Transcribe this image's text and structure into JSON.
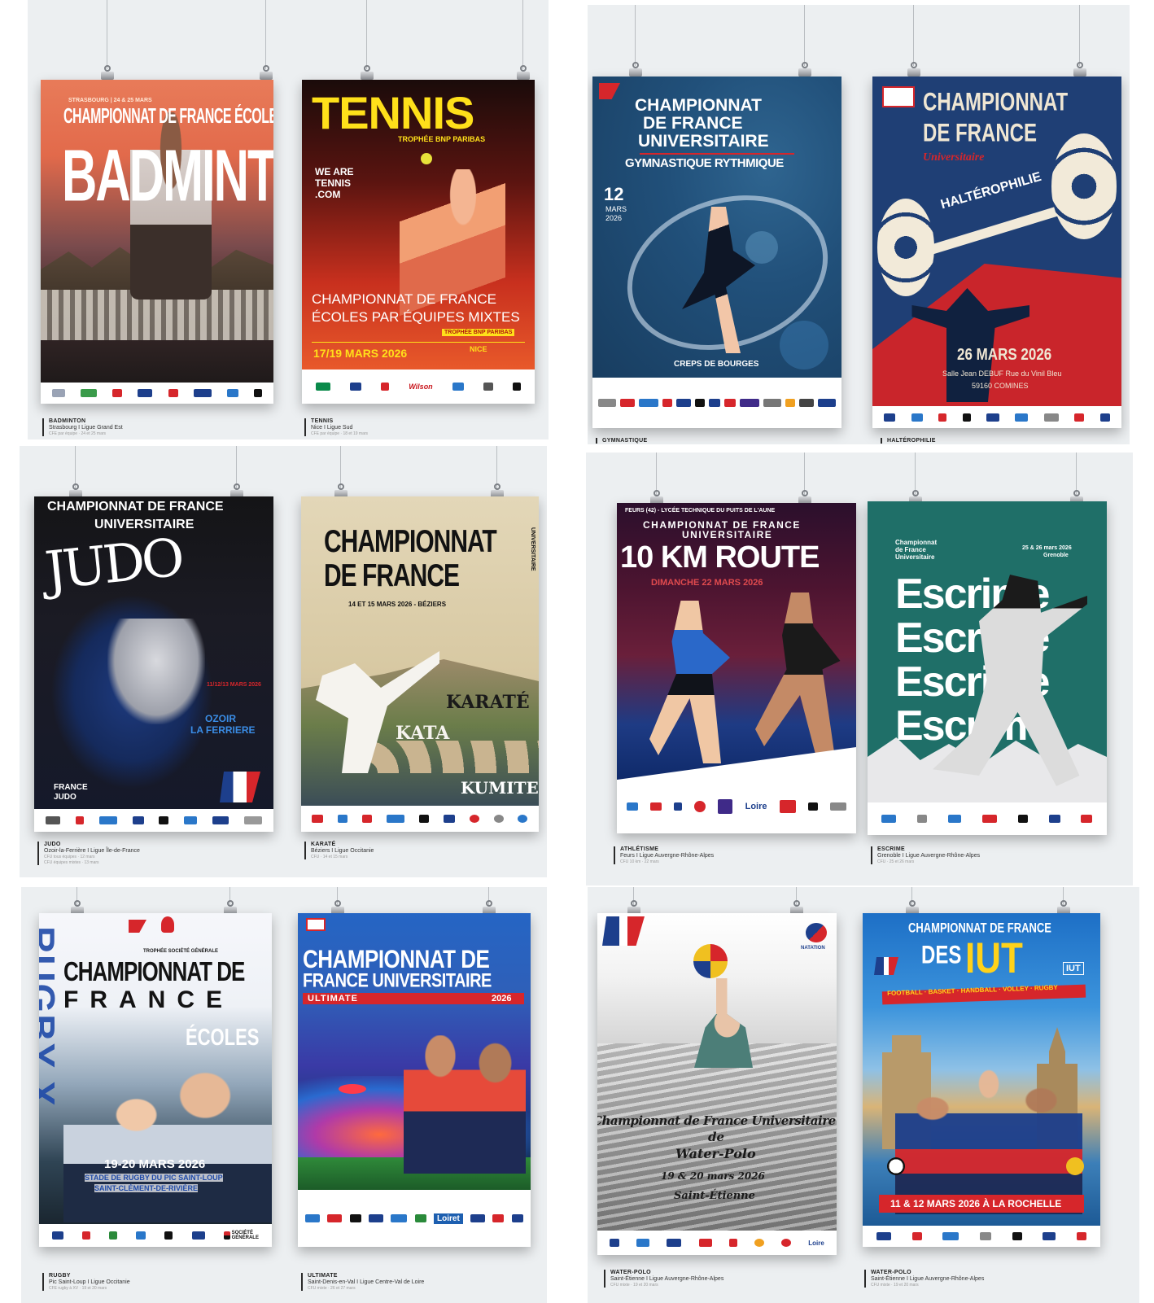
{
  "posters": {
    "badminton": {
      "top_line": "STRASBOURG | 24 & 25 MARS",
      "title": "CHAMPIONNAT DE FRANCE ÉCOLES",
      "sport": "BADMINTON",
      "caption": {
        "sport": "BADMINTON",
        "location": "Strasbourg I Ligue Grand Est",
        "sub": "CFE par équipe · 24 et 25 mars"
      }
    },
    "tennis": {
      "title": "TENNIS",
      "trophy": "TROPHÉE BNP PARIBAS",
      "slogan": [
        "WE ARE",
        "TENNIS",
        ".COM"
      ],
      "championship": "CHAMPIONNAT DE FRANCE",
      "subtitle": "ÉCOLES PAR ÉQUIPES MIXTES",
      "badge": "TROPHÉE BNP PARIBAS",
      "dates": "17/19 MARS 2026",
      "city": "NICE",
      "sponsor": "Wilson",
      "caption": {
        "sport": "TENNIS",
        "location": "Nice I Ligue Sud",
        "sub": "CFE par équipe · 18 et 19 mars"
      }
    },
    "gym": {
      "title": [
        "CHAMPIONNAT",
        "DE FRANCE",
        "UNIVERSITAIRE"
      ],
      "discipline": "GYMNASTIQUE RYTHMIQUE",
      "date_day": "12",
      "date_month": "MARS",
      "date_year": "2026",
      "venue": "CREPS DE BOURGES",
      "caption": {
        "sport": "GYMNASTIQUE"
      }
    },
    "halterophilie": {
      "title": [
        "CHAMPIONNAT",
        "DE FRANCE"
      ],
      "subtitle": "Universitaire",
      "discipline": "HALTÉROPHILIE",
      "date": "26 MARS 2026",
      "address": "Salle Jean DEBUF Rue du Vinil Bleu",
      "postcode": "59160 COMINES",
      "caption": {
        "sport": "HALTÉROPHILIE"
      }
    },
    "judo": {
      "title": [
        "CHAMPIONNAT DE FRANCE",
        "UNIVERSITAIRE"
      ],
      "sport": "JUDO",
      "dates": "11/12/13 MARS 2026",
      "city": [
        "OZOIR",
        "LA FERRIERE"
      ],
      "brand": [
        "FRANCE",
        "JUDO"
      ],
      "caption": {
        "sport": "JUDO",
        "location": "Ozoir-la-Ferrière I Ligue Île-de-France",
        "sub": "CFU tous équipes · 12 mars",
        "sub2": "CFU équipes mixtes · 13 mars"
      }
    },
    "karate": {
      "title": [
        "CHAMPIONNAT",
        "DE FRANCE"
      ],
      "side": "UNIVERSITAIRE",
      "dates": "14 ET 15 MARS 2026 - BÉZIERS",
      "disciplines": [
        "KARATÉ",
        "KATA",
        "KUMITE"
      ],
      "caption": {
        "sport": "KARATÉ",
        "location": "Béziers I Ligue Occitanie",
        "sub": "CFU · 14 et 15 mars"
      }
    },
    "athletisme": {
      "top": "FEURS (42) - LYCÉE TECHNIQUE DU PUITS DE L'AUNE",
      "title": [
        "CHAMPIONNAT DE FRANCE",
        "UNIVERSITAIRE"
      ],
      "event": "10 KM ROUTE",
      "date": "DIMANCHE 22 MARS 2026",
      "sponsor": "Loire",
      "caption": {
        "sport": "ATHLÉTISME",
        "location": "Feurs I Ligue Auvergne-Rhône-Alpes",
        "sub": "CFU 10 km · 22 mars"
      }
    },
    "escrime": {
      "header": [
        "Championnat",
        "de France",
        "Universitaire"
      ],
      "dates": [
        "25 & 26 mars 2026",
        "Grenoble"
      ],
      "word": "Escrime",
      "caption": {
        "sport": "ESCRIME",
        "location": "Grenoble I Ligue Auvergne-Rhône-Alpes",
        "sub": "CFU · 25 et 26 mars"
      }
    },
    "rugby": {
      "trophy": "TROPHÉE SOCIÉTÉ GÉNÉRALE",
      "title": [
        "CHAMPIONNAT DE",
        "FRANCE"
      ],
      "sub": "ÉCOLES",
      "vertical": "RUGBY X",
      "dates": "19-20 MARS 2026",
      "venue": [
        "STADE DE RUGBY DU PIC SAINT-LOUP",
        "SAINT-CLÉMENT-DE-RIVIÈRE"
      ],
      "sponsor": [
        "SOCIÉTÉ",
        "GÉNÉRALE"
      ],
      "caption": {
        "sport": "RUGBY",
        "location": "Pic Saint-Loup I Ligue Occitanie",
        "sub": "CFE rugby à XV · 19 et 20 mars"
      }
    },
    "ultimate": {
      "title": [
        "CHAMPIONNAT DE",
        "FRANCE UNIVERSITAIRE"
      ],
      "sport": "ULTIMATE",
      "year": "2026",
      "sponsor": "Loiret",
      "caption": {
        "sport": "ULTIMATE",
        "location": "Saint-Denis-en-Val I Ligue Centre-Val de Loire",
        "sub": "CFU mixte · 26 et 27 mars"
      }
    },
    "waterpolo": {
      "brand": "NATATION",
      "title": [
        "Championnat de France Universitaire",
        "de",
        "Water-Polo"
      ],
      "dates": "19 & 20 mars 2026",
      "city": "Saint-Étienne",
      "sponsor": "Loire",
      "caption": {
        "sport": "WATER-POLO",
        "location": "Saint-Étienne I Ligue Auvergne-Rhône-Alpes",
        "sub": "CFU mixte · 19 et 20 mars"
      }
    },
    "iut": {
      "title": [
        "CHAMPIONNAT DE FRANCE",
        "DES",
        "IUT"
      ],
      "badge": "IUT",
      "sports": "FOOTBALL · BASKET · HANDBALL · VOLLEY · RUGBY",
      "dates": "11 & 12 MARS 2026 À LA ROCHELLE",
      "caption": {
        "sport": "WATER-POLO",
        "location": "Saint-Étienne I Ligue Auvergne-Rhône-Alpes",
        "sub": "CFU mixte · 19 et 20 mars"
      }
    }
  },
  "colors": {
    "panel": "#eceff1",
    "ffsu_blue": "#1d3f8c",
    "ffsu_red": "#d6262b"
  },
  "icons": [
    "paper-clip-icon",
    "ffsu-logo-icon",
    "sponsor-logo-icon"
  ]
}
